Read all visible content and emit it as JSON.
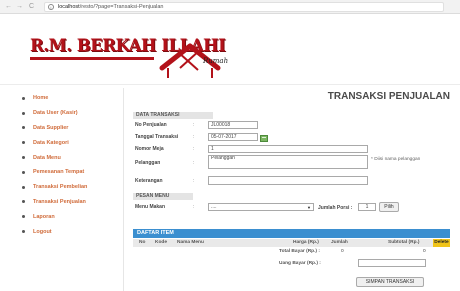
{
  "browser": {
    "back": "←",
    "forward": "→",
    "reload": "C",
    "info_icon": "i",
    "url_host": "localhost",
    "url_path": "/resto/?page=Transaksi-Penjualan"
  },
  "brand": {
    "name": "R.M. BERKAH ILLAHI",
    "tagline": "Rumah",
    "color": "#b3121a"
  },
  "sidebar": {
    "items": [
      {
        "label": "Home"
      },
      {
        "label": "Data User (Kasir)"
      },
      {
        "label": "Data Supplier"
      },
      {
        "label": "Data Kategori"
      },
      {
        "label": "Data Menu"
      },
      {
        "label": "Pemesanan Tempat"
      },
      {
        "label": "Transaksi Pembelian"
      },
      {
        "label": "Transaksi Penjualan"
      },
      {
        "label": "Laporan"
      },
      {
        "label": "Logout"
      }
    ],
    "link_color": "#d06b3a"
  },
  "page": {
    "title": "TRANSAKSI PENJUALAN"
  },
  "form": {
    "section_transaksi": "DATA TRANSAKSI",
    "no_penjualan_label": "No Penjualan",
    "no_penjualan_value": "JL00018",
    "tanggal_label": "Tanggal Transaksi",
    "tanggal_value": "05-07-2017",
    "meja_label": "Nomor Meja",
    "meja_value": "1",
    "pelanggan_label": "Pelanggan",
    "pelanggan_value": "Pelanggan",
    "pelanggan_hint": "* Diisi nama pelanggan",
    "keterangan_label": "Keterangan",
    "keterangan_value": "",
    "colon": ":"
  },
  "pesan": {
    "section_label": "PESAN MENU",
    "menu_label": "Menu Makan",
    "menu_selected": "....",
    "porsi_label": "Jumlah Porsi :",
    "porsi_value": "1",
    "pilih_button": "Pilih"
  },
  "daftar": {
    "title": "DAFTAR ITEM",
    "columns": [
      "No",
      "Kode",
      "Nama Menu",
      "Harga (Rp.)",
      "Jumlah",
      "Subtotal (Rp.)",
      "Delete"
    ],
    "total_label": "Total Bayar (Rp.) :",
    "total_qty": "0",
    "total_value": "0",
    "uang_label": "Uang Bayar (Rp.) :",
    "uang_value": "",
    "header_color": "#3b8fd0",
    "delete_color": "#f0c419"
  },
  "actions": {
    "save_button": "SIMPAN TRANSAKSI"
  }
}
